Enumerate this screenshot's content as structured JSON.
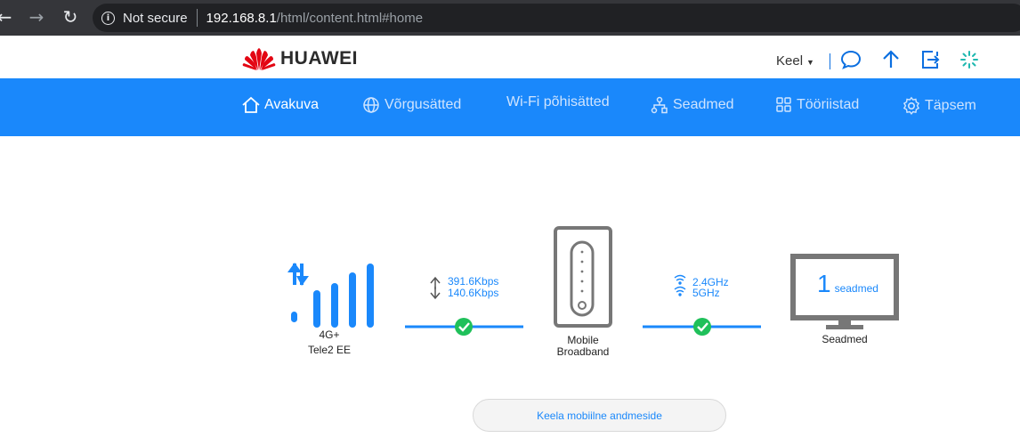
{
  "browser": {
    "not_secure": "Not secure",
    "url_host": "192.168.8.1",
    "url_path": "/html/content.html#home"
  },
  "header": {
    "brand": "HUAWEI",
    "language_label": "Keel"
  },
  "nav": {
    "items": [
      {
        "label": "Avakuva",
        "active": true
      },
      {
        "label": "Võrgusätted"
      },
      {
        "label": "Wi-Fi põhisätted"
      },
      {
        "label": "Seadmed"
      },
      {
        "label": "Tööriistad"
      },
      {
        "label": "Täpsem"
      }
    ]
  },
  "status": {
    "network_type": "4G+",
    "operator": "Tele2 EE",
    "upload_rate": "391.6Kbps",
    "download_rate": "140.6Kbps",
    "device_name_line1": "Mobile",
    "device_name_line2": "Broadband",
    "wifi_band_1": "2.4GHz",
    "wifi_band_2": "5GHz",
    "connected_devices_count": "1",
    "connected_devices_unit": "seadmed",
    "devices_label": "Seadmed"
  },
  "actions": {
    "disable_mobile_data": "Keela mobiilne andmeside"
  },
  "colors": {
    "brand_blue": "#1a88fb",
    "success_green": "#1fc05a",
    "huawei_red": "#e30613"
  }
}
